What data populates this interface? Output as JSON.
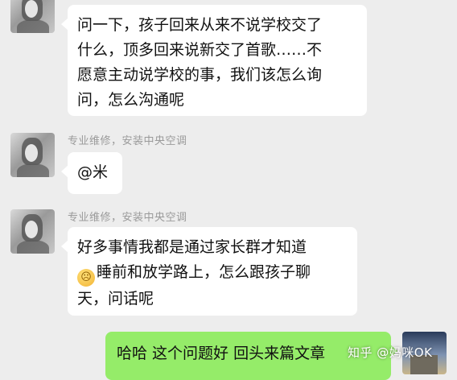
{
  "messages": [
    {
      "sender": "",
      "lines": [
        "问一下，孩子回来从来不说学校交了",
        "什么，顶多回来说新交了首歌……不",
        "愿意主动说学校的事，我们该怎么询",
        "问，怎么沟通呢"
      ]
    },
    {
      "sender": "专业维修，安装中央空调",
      "lines": [
        "@米"
      ]
    },
    {
      "sender": "专业维修，安装中央空调",
      "lines": [
        "好多事情我都是通过家长群才知道",
        "睡前和放学路上，怎么跟孩子聊",
        "天，问话呢"
      ],
      "emoji": "worried-face"
    },
    {
      "sender": "",
      "lines": [
        "哈哈 这个问题好 回头来篇文章"
      ],
      "own": true
    }
  ],
  "watermark": "知乎 @妈咪OK",
  "colors": {
    "background": "#ededed",
    "incoming_bubble": "#ffffff",
    "outgoing_bubble": "#95ec69",
    "sender_text": "#9a9a9a"
  }
}
